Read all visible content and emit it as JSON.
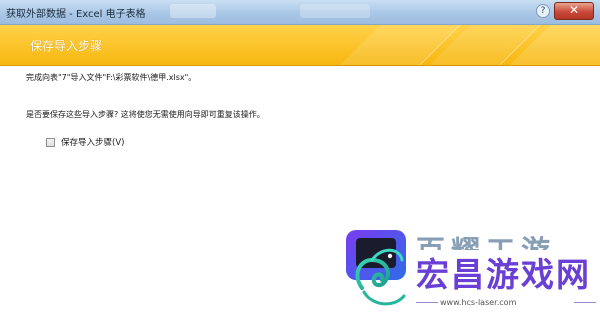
{
  "window": {
    "title": "获取外部数据 - Excel 电子表格",
    "close_label": "✕",
    "help_label": "?"
  },
  "header": {
    "title": "保存导入步骤"
  },
  "content": {
    "message_done": "完成向表\"7\"导入文件\"F:\\彩票软件\\德甲.xlsx\"。",
    "message_question": "是否要保存这些导入步骤? 这将使您无需使用向导即可重复该操作。",
    "checkbox_label": "保存导入步骤(V)",
    "checkbox_checked": false
  },
  "watermark": {
    "ghost_text": "百耀工游",
    "brand_text": "宏昌游戏网",
    "url_text": "www.hcs-laser.com"
  },
  "colors": {
    "header_yellow": "#f7b70f",
    "titlebar_blue": "#a9c7e6",
    "close_red": "#c9493a",
    "brand_purple": "#6a3fd6"
  }
}
